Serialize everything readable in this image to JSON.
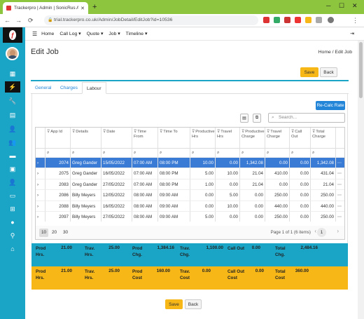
{
  "browser": {
    "tab_title": "Trackerpro | Admin | SonicRus A",
    "url": "trial.trackerpro.co.uk/Admin/JobDetail/EditJob?id=10536"
  },
  "topnav": {
    "items": [
      "Home",
      "Call Log ▾",
      "Quote ▾",
      "Job ▾",
      "Timeline ▾"
    ]
  },
  "page": {
    "title": "Edit Job",
    "breadcrumb": "Home  /  Edit Job"
  },
  "buttons": {
    "save": "Save",
    "back": "Back",
    "recalc": "Re-Calc Rate"
  },
  "tabs": [
    "General",
    "Charges",
    "Labour"
  ],
  "search": {
    "placeholder": "Search..."
  },
  "grid": {
    "headers": [
      "App Id",
      "Details",
      "Date",
      "Time From",
      "Time To",
      "Productive Hrs",
      "Travel Hrs",
      "Productive Charge",
      "Travel Charge",
      "Call Out",
      "Total Charge"
    ],
    "rows": [
      [
        "2074",
        "Greg Gander",
        "15/05/2022",
        "07:00 AM",
        "08:00 PM",
        "10.00",
        "0.00",
        "1,342.08",
        "0.00",
        "0.00",
        "1,342.08"
      ],
      [
        "2075",
        "Greg Gander",
        "16/05/2022",
        "07:00 AM",
        "08:00 PM",
        "5.00",
        "10.00",
        "21.04",
        "410.00",
        "0.00",
        "431.04"
      ],
      [
        "2083",
        "Greg Gander",
        "27/05/2022",
        "07:00 AM",
        "08:00 PM",
        "1.00",
        "0.00",
        "21.04",
        "0.00",
        "0.00",
        "21.04"
      ],
      [
        "2086",
        "Billy Meyers",
        "12/05/2022",
        "08:00 AM",
        "09:00 AM",
        "0.00",
        "5.00",
        "0.00",
        "250.00",
        "0.00",
        "250.00"
      ],
      [
        "2088",
        "Billy Meyers",
        "16/05/2022",
        "08:00 AM",
        "09:00 AM",
        "0.00",
        "10.00",
        "0.00",
        "440.00",
        "0.00",
        "440.00"
      ],
      [
        "2097",
        "Billy Meyers",
        "27/05/2022",
        "08:00 AM",
        "09:00 AM",
        "5.00",
        "0.00",
        "0.00",
        "250.00",
        "0.00",
        "250.00"
      ]
    ]
  },
  "pager": {
    "sizes": [
      "10",
      "20",
      "30"
    ],
    "info": "Page 1 of 1 (6 items)",
    "page": "1"
  },
  "summary_row1": {
    "labels": [
      "Prod\nHrs.",
      "Trav.\nHrs.",
      "Prod\nChg.",
      "Trav.\nChg.",
      "Call Out",
      "Total\nChg."
    ],
    "values": [
      "21.00",
      "25.00",
      "1,384.16",
      "1,100.00",
      "0.00",
      "2,484.16"
    ]
  },
  "summary_row2": {
    "labels": [
      "Prod\nHrs.",
      "Trav.\nHrs.",
      "Prod\nCost",
      "Trav.\nCost",
      "Call Out\nCost",
      "Total\nCost"
    ],
    "values": [
      "21.00",
      "25.00",
      "160.00",
      "0.00",
      "0.00",
      "360.00"
    ]
  }
}
